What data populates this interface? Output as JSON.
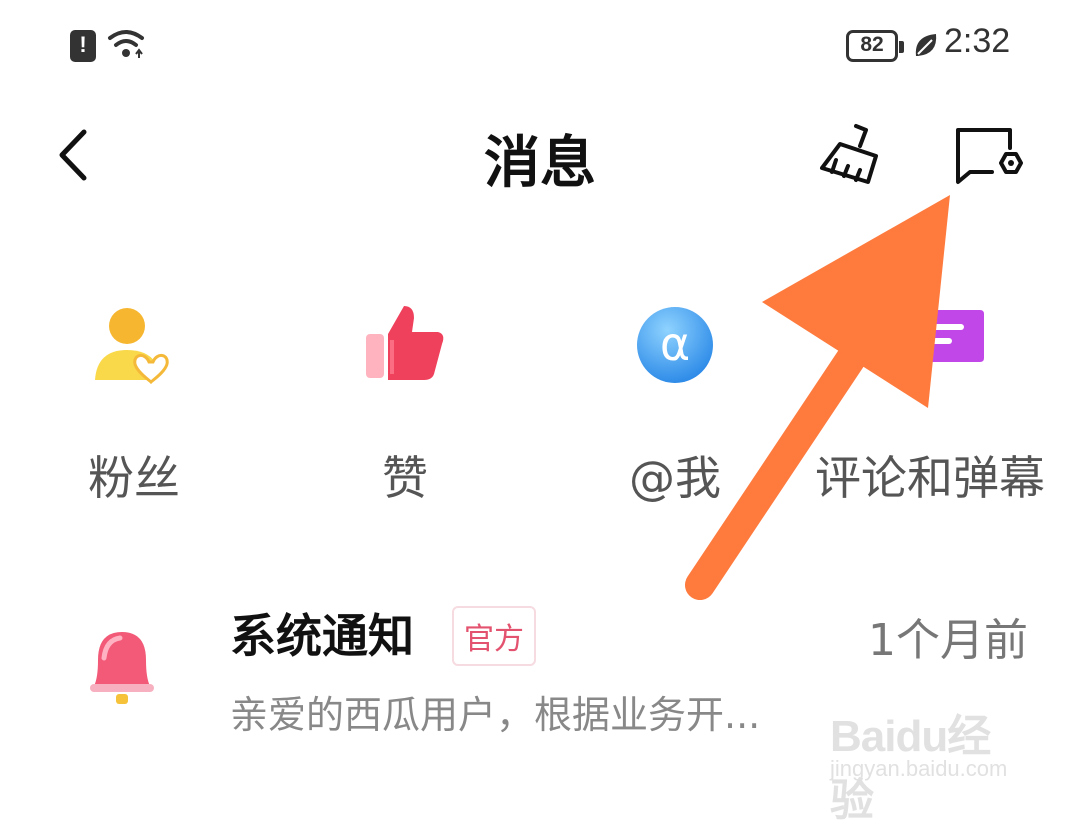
{
  "status_bar": {
    "battery": "82",
    "time": "2:32",
    "icons": [
      "alert-icon",
      "wifi-icon",
      "battery-icon",
      "leaf-icon"
    ]
  },
  "header": {
    "title": "消息",
    "back_icon": "chevron-left-icon",
    "clean_icon": "broom-icon",
    "settings_icon": "message-settings-icon"
  },
  "categories": [
    {
      "label": "粉丝",
      "icon": "fans-icon"
    },
    {
      "label": "赞",
      "icon": "thumbs-up-icon"
    },
    {
      "label": "@我",
      "icon": "at-icon"
    },
    {
      "label": "评论和弹幕",
      "icon": "comment-icon"
    }
  ],
  "notification": {
    "title": "系统通知",
    "badge": "官方",
    "time": "1个月前",
    "preview": "亲爱的西瓜用户，根据业务开...",
    "icon": "bell-icon"
  },
  "watermark": {
    "logo_text": "Baidu经验",
    "url": "jingyan.baidu.com"
  },
  "colors": {
    "arrow": "#ff7a3d",
    "badge_text": "#e3526f",
    "fans_icon": "#f7c533",
    "likes_icon": "#f0415c",
    "at_icon": "#3aa1f2",
    "comment_icon": "#b53ce0"
  }
}
